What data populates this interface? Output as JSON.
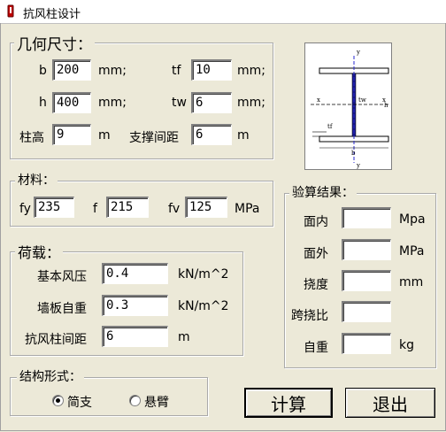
{
  "window": {
    "title": "抗风柱设计"
  },
  "geometry": {
    "legend": "几何尺寸：",
    "b": {
      "label": "b",
      "value": "200",
      "unit": "mm;"
    },
    "h": {
      "label": "h",
      "value": "400",
      "unit": "mm;"
    },
    "tf": {
      "label": "tf",
      "value": "10",
      "unit": "mm;"
    },
    "tw": {
      "label": "tw",
      "value": "6",
      "unit": "mm;"
    },
    "col_height": {
      "label": "柱高",
      "value": "9",
      "unit": "m"
    },
    "brace_spacing": {
      "label": "支撑间距",
      "value": "6",
      "unit": "m"
    }
  },
  "diagram": {
    "labels": {
      "y_top": "y",
      "y_bottom": "y",
      "x_left": "x",
      "x_right": "x",
      "tw": "tw",
      "tf": "tf",
      "b": "b",
      "h": "h"
    }
  },
  "material": {
    "legend": "材料：",
    "fy": {
      "label": "fy",
      "value": "235"
    },
    "f": {
      "label": "f",
      "value": "215"
    },
    "fv": {
      "label": "fv",
      "value": "125",
      "unit": "MPa"
    }
  },
  "load": {
    "legend": "荷载：",
    "wind_pressure": {
      "label": "基本风压",
      "value": "0.4",
      "unit": "kN/m^2"
    },
    "wall_weight": {
      "label": "墙板自重",
      "value": "0.3",
      "unit": "kN/m^2"
    },
    "column_spacing": {
      "label": "抗风柱间距",
      "value": "6",
      "unit": "m"
    }
  },
  "results": {
    "legend": "验算结果：",
    "in_plane": {
      "label": "面内",
      "value": "",
      "unit": "Mpa"
    },
    "out_plane": {
      "label": "面外",
      "value": "",
      "unit": "MPa"
    },
    "deflection": {
      "label": "挠度",
      "value": "",
      "unit": "mm"
    },
    "span_ratio": {
      "label": "跨挠比",
      "value": ""
    },
    "self_weight": {
      "label": "自重",
      "value": "",
      "unit": "kg"
    }
  },
  "structure": {
    "legend": "结构形式：",
    "options": [
      {
        "label": "简支",
        "selected": true
      },
      {
        "label": "悬臂",
        "selected": false
      }
    ]
  },
  "buttons": {
    "calculate": "计算",
    "exit": "退出"
  }
}
